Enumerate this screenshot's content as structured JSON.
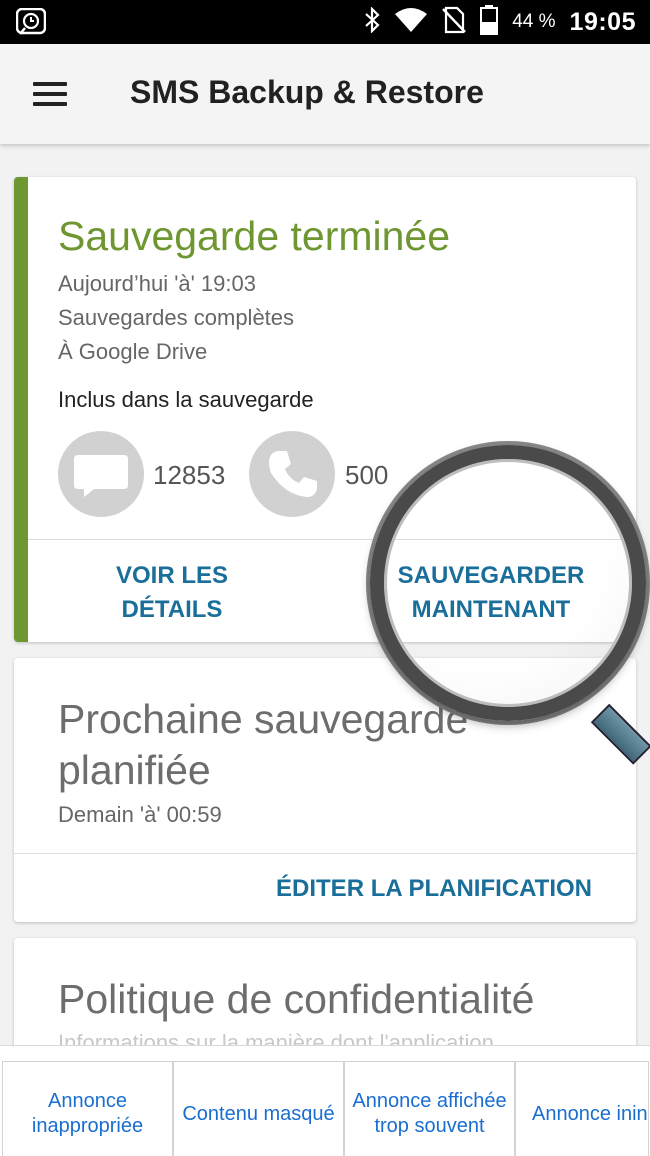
{
  "status_bar": {
    "battery_percent": "44 %",
    "time": "19:05",
    "icons": [
      "alarm-icon",
      "bluetooth-icon",
      "wifi-icon",
      "no-sim-icon",
      "battery-icon"
    ]
  },
  "app_bar": {
    "title": "SMS Backup & Restore",
    "menu_icon": "hamburger-menu-icon"
  },
  "backup_card": {
    "title": "Sauvegarde terminée",
    "date": "Aujourd’hui 'à' 19:03",
    "type": "Sauvegardes complètes",
    "destination": "À Google Drive",
    "included_label": "Inclus dans la sauvegarde",
    "sms_count": "12853",
    "call_count": "500",
    "details_button": [
      "VOIR LES",
      "DÉTAILS"
    ],
    "backup_now_button": [
      "SAUVEGARDER",
      "MAINTENANT"
    ],
    "accent_color": "#6e9631"
  },
  "schedule_card": {
    "title": "Prochaine sauvegarde planifiée",
    "next": "Demain 'à' 00:59",
    "edit_button": "ÉDITER LA PLANIFICATION"
  },
  "privacy_card": {
    "title": "Politique de confidentialité",
    "subtitle": "Informations sur la manière dont l'application"
  },
  "ad_feedback": [
    {
      "label": "Annonce inappropriée"
    },
    {
      "label": "Contenu masqué"
    },
    {
      "label": "Annonce affichée trop souvent"
    },
    {
      "label": "Annonce inintéressante"
    }
  ],
  "colors": {
    "action_blue": "#1a6e9a",
    "ad_link_blue": "#1a6ed0"
  }
}
